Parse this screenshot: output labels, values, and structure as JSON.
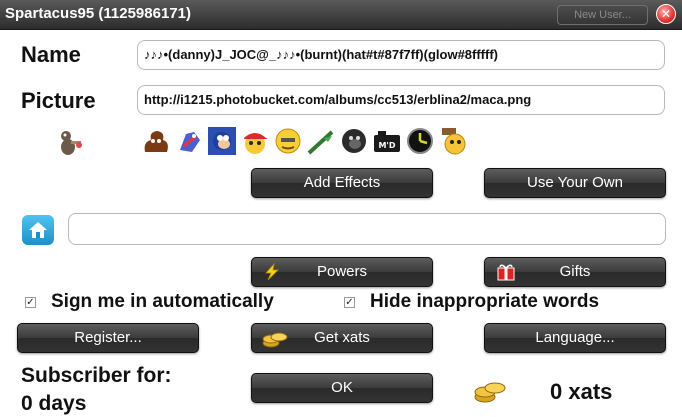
{
  "window": {
    "title": "Spartacus95 (1125986171)",
    "new_user": "New User...",
    "close": "✕"
  },
  "name": {
    "label": "Name",
    "value": "♪♪♪•(danny)J_JOC@_♪♪♪•(burnt)(hat#t#87f7ff)(glow#8fffff)"
  },
  "picture": {
    "label": "Picture",
    "value": "http://i1215.photobucket.com/albums/cc513/erblina2/maca.png"
  },
  "emotes": [
    "poo-emote-icon",
    "bird-emote-icon",
    "hedgehog-emote-icon",
    "cap-face-emote-icon",
    "yellow-face-emote-icon",
    "stick-emote-icon",
    "gorilla-emote-icon",
    "camera-emote-icon",
    "clock-emote-icon",
    "sandwich-face-emote-icon"
  ],
  "buttons": {
    "add_effects": "Add Effects",
    "use_your_own": "Use Your Own",
    "powers": "Powers",
    "gifts": "Gifts",
    "register": "Register...",
    "get_xats": "Get xats",
    "language": "Language...",
    "ok": "OK"
  },
  "homepage": {
    "value": ""
  },
  "options": {
    "sign_in_auto": {
      "label": "Sign me in automatically",
      "checked": true,
      "mark": "✓"
    },
    "hide_words": {
      "label": "Hide inappropriate words",
      "checked": true,
      "mark": "✓"
    }
  },
  "subscriber": {
    "label": "Subscriber for:",
    "value": "0 days"
  },
  "xats": {
    "value": "0 xats"
  },
  "colors": {
    "titlebar": "#3a3a3a",
    "button": "#3b3b3b",
    "close": "#e13434"
  }
}
